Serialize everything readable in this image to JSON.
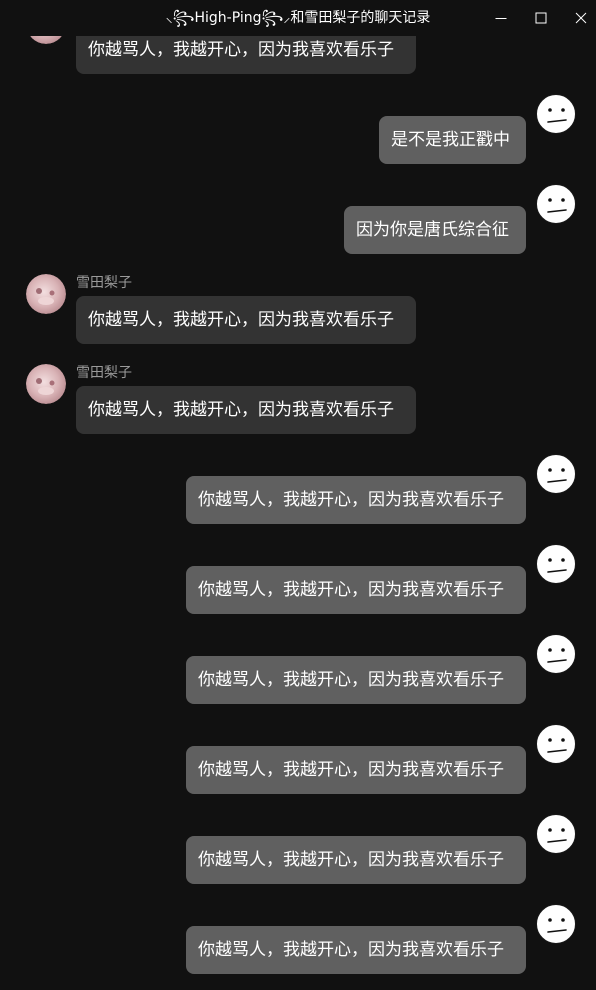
{
  "window": {
    "title": "⸜꧂High-Ping꧂⸝和雪田梨子的聊天记录",
    "controls": [
      "minimize-icon",
      "maximize-icon",
      "close-icon"
    ]
  },
  "colors": {
    "background": "#111111",
    "bubble_incoming": "#333333",
    "bubble_outgoing": "#606060",
    "sender_name": "#9a9a9a",
    "text": "#ffffff"
  },
  "messages": [
    {
      "side": "in",
      "sender": "",
      "text": "你越骂人，我越开心，因为我喜欢看乐子"
    },
    {
      "side": "out",
      "text": "是不是我正戳中"
    },
    {
      "side": "out",
      "text": "因为你是唐氏综合征"
    },
    {
      "side": "in",
      "sender": "雪田梨子",
      "text": "你越骂人，我越开心，因为我喜欢看乐子"
    },
    {
      "side": "in",
      "sender": "雪田梨子",
      "text": "你越骂人，我越开心，因为我喜欢看乐子"
    },
    {
      "side": "out",
      "text": "你越骂人，我越开心，因为我喜欢看乐子"
    },
    {
      "side": "out",
      "text": "你越骂人，我越开心，因为我喜欢看乐子"
    },
    {
      "side": "out",
      "text": "你越骂人，我越开心，因为我喜欢看乐子"
    },
    {
      "side": "out",
      "text": "你越骂人，我越开心，因为我喜欢看乐子"
    },
    {
      "side": "out",
      "text": "你越骂人，我越开心，因为我喜欢看乐子"
    },
    {
      "side": "out",
      "text": "你越骂人，我越开心，因为我喜欢看乐子"
    }
  ]
}
